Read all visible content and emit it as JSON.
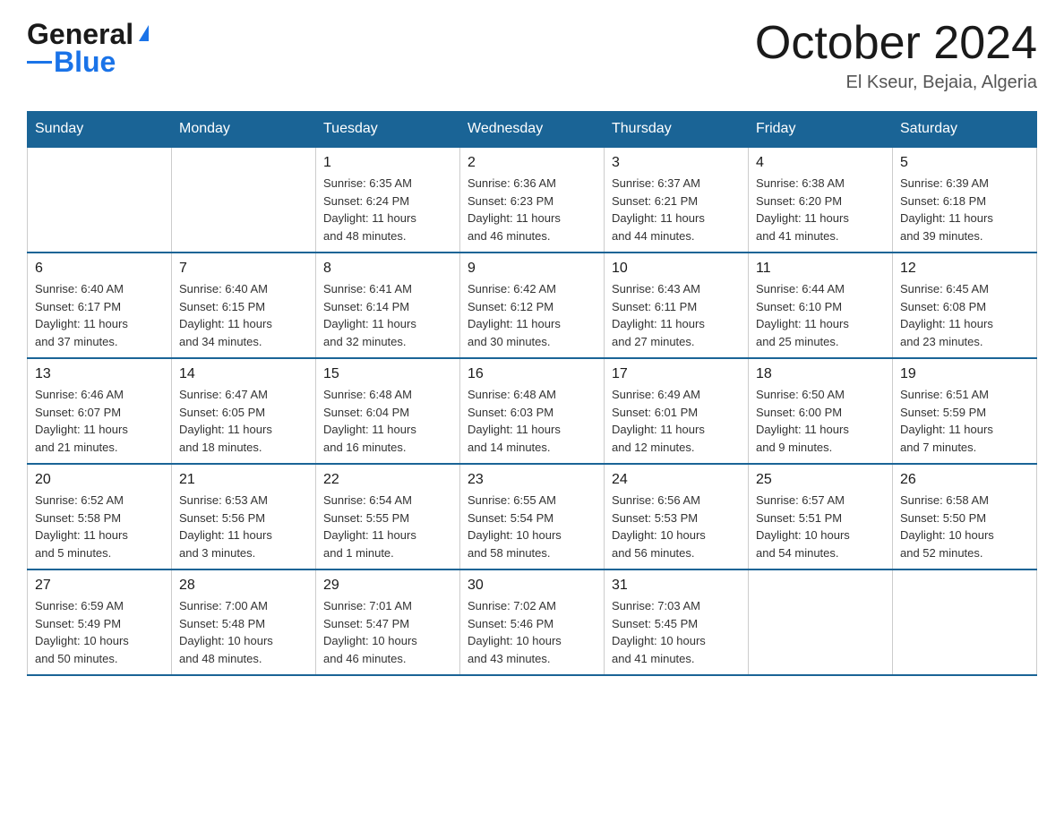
{
  "logo": {
    "general": "General",
    "blue": "Blue"
  },
  "title": "October 2024",
  "location": "El Kseur, Bejaia, Algeria",
  "days_of_week": [
    "Sunday",
    "Monday",
    "Tuesday",
    "Wednesday",
    "Thursday",
    "Friday",
    "Saturday"
  ],
  "weeks": [
    [
      {
        "day": "",
        "info": ""
      },
      {
        "day": "",
        "info": ""
      },
      {
        "day": "1",
        "info": "Sunrise: 6:35 AM\nSunset: 6:24 PM\nDaylight: 11 hours\nand 48 minutes."
      },
      {
        "day": "2",
        "info": "Sunrise: 6:36 AM\nSunset: 6:23 PM\nDaylight: 11 hours\nand 46 minutes."
      },
      {
        "day": "3",
        "info": "Sunrise: 6:37 AM\nSunset: 6:21 PM\nDaylight: 11 hours\nand 44 minutes."
      },
      {
        "day": "4",
        "info": "Sunrise: 6:38 AM\nSunset: 6:20 PM\nDaylight: 11 hours\nand 41 minutes."
      },
      {
        "day": "5",
        "info": "Sunrise: 6:39 AM\nSunset: 6:18 PM\nDaylight: 11 hours\nand 39 minutes."
      }
    ],
    [
      {
        "day": "6",
        "info": "Sunrise: 6:40 AM\nSunset: 6:17 PM\nDaylight: 11 hours\nand 37 minutes."
      },
      {
        "day": "7",
        "info": "Sunrise: 6:40 AM\nSunset: 6:15 PM\nDaylight: 11 hours\nand 34 minutes."
      },
      {
        "day": "8",
        "info": "Sunrise: 6:41 AM\nSunset: 6:14 PM\nDaylight: 11 hours\nand 32 minutes."
      },
      {
        "day": "9",
        "info": "Sunrise: 6:42 AM\nSunset: 6:12 PM\nDaylight: 11 hours\nand 30 minutes."
      },
      {
        "day": "10",
        "info": "Sunrise: 6:43 AM\nSunset: 6:11 PM\nDaylight: 11 hours\nand 27 minutes."
      },
      {
        "day": "11",
        "info": "Sunrise: 6:44 AM\nSunset: 6:10 PM\nDaylight: 11 hours\nand 25 minutes."
      },
      {
        "day": "12",
        "info": "Sunrise: 6:45 AM\nSunset: 6:08 PM\nDaylight: 11 hours\nand 23 minutes."
      }
    ],
    [
      {
        "day": "13",
        "info": "Sunrise: 6:46 AM\nSunset: 6:07 PM\nDaylight: 11 hours\nand 21 minutes."
      },
      {
        "day": "14",
        "info": "Sunrise: 6:47 AM\nSunset: 6:05 PM\nDaylight: 11 hours\nand 18 minutes."
      },
      {
        "day": "15",
        "info": "Sunrise: 6:48 AM\nSunset: 6:04 PM\nDaylight: 11 hours\nand 16 minutes."
      },
      {
        "day": "16",
        "info": "Sunrise: 6:48 AM\nSunset: 6:03 PM\nDaylight: 11 hours\nand 14 minutes."
      },
      {
        "day": "17",
        "info": "Sunrise: 6:49 AM\nSunset: 6:01 PM\nDaylight: 11 hours\nand 12 minutes."
      },
      {
        "day": "18",
        "info": "Sunrise: 6:50 AM\nSunset: 6:00 PM\nDaylight: 11 hours\nand 9 minutes."
      },
      {
        "day": "19",
        "info": "Sunrise: 6:51 AM\nSunset: 5:59 PM\nDaylight: 11 hours\nand 7 minutes."
      }
    ],
    [
      {
        "day": "20",
        "info": "Sunrise: 6:52 AM\nSunset: 5:58 PM\nDaylight: 11 hours\nand 5 minutes."
      },
      {
        "day": "21",
        "info": "Sunrise: 6:53 AM\nSunset: 5:56 PM\nDaylight: 11 hours\nand 3 minutes."
      },
      {
        "day": "22",
        "info": "Sunrise: 6:54 AM\nSunset: 5:55 PM\nDaylight: 11 hours\nand 1 minute."
      },
      {
        "day": "23",
        "info": "Sunrise: 6:55 AM\nSunset: 5:54 PM\nDaylight: 10 hours\nand 58 minutes."
      },
      {
        "day": "24",
        "info": "Sunrise: 6:56 AM\nSunset: 5:53 PM\nDaylight: 10 hours\nand 56 minutes."
      },
      {
        "day": "25",
        "info": "Sunrise: 6:57 AM\nSunset: 5:51 PM\nDaylight: 10 hours\nand 54 minutes."
      },
      {
        "day": "26",
        "info": "Sunrise: 6:58 AM\nSunset: 5:50 PM\nDaylight: 10 hours\nand 52 minutes."
      }
    ],
    [
      {
        "day": "27",
        "info": "Sunrise: 6:59 AM\nSunset: 5:49 PM\nDaylight: 10 hours\nand 50 minutes."
      },
      {
        "day": "28",
        "info": "Sunrise: 7:00 AM\nSunset: 5:48 PM\nDaylight: 10 hours\nand 48 minutes."
      },
      {
        "day": "29",
        "info": "Sunrise: 7:01 AM\nSunset: 5:47 PM\nDaylight: 10 hours\nand 46 minutes."
      },
      {
        "day": "30",
        "info": "Sunrise: 7:02 AM\nSunset: 5:46 PM\nDaylight: 10 hours\nand 43 minutes."
      },
      {
        "day": "31",
        "info": "Sunrise: 7:03 AM\nSunset: 5:45 PM\nDaylight: 10 hours\nand 41 minutes."
      },
      {
        "day": "",
        "info": ""
      },
      {
        "day": "",
        "info": ""
      }
    ]
  ]
}
